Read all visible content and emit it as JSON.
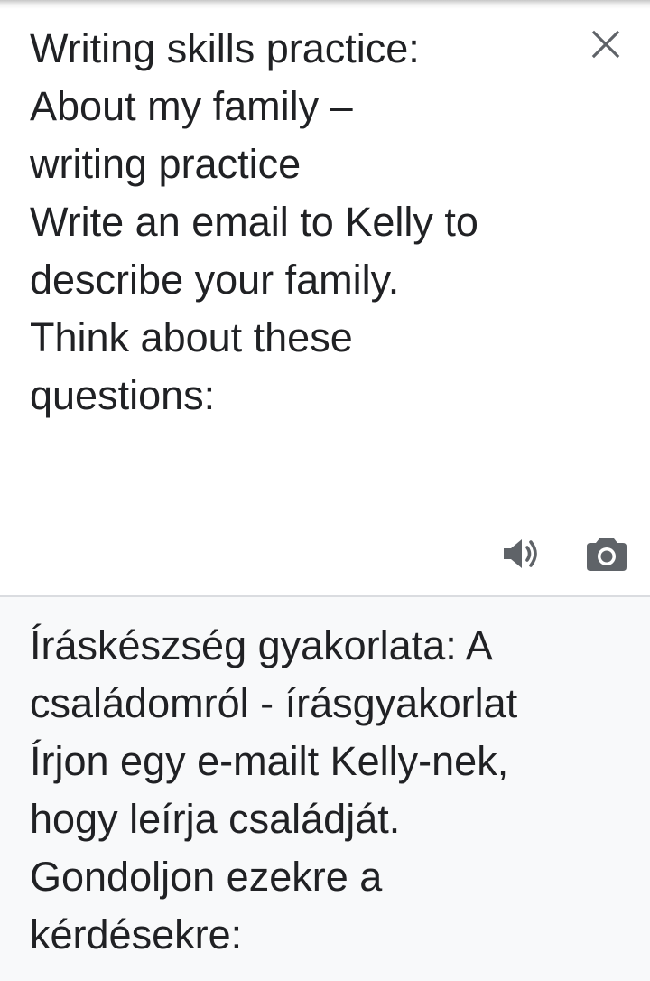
{
  "source": {
    "text": "Writing skills practice:\nAbout my family –\nwriting practice\nWrite an email to Kelly to\ndescribe your family.\nThink about these\nquestions:"
  },
  "translation": {
    "text": "Íráskészség gyakorlata: A\ncsaládomról - írásgyakorlat\nÍrjon egy e-mailt Kelly-nek,\nhogy leírja családját.\nGondoljon ezekre a\nkérdésekre:"
  },
  "icons": {
    "close": "close-icon",
    "speaker": "speaker-icon",
    "camera": "camera-icon"
  },
  "colors": {
    "text": "#202124",
    "icon": "#5f6368",
    "translation_background": "#f8f9fa",
    "divider": "#dadce0"
  }
}
